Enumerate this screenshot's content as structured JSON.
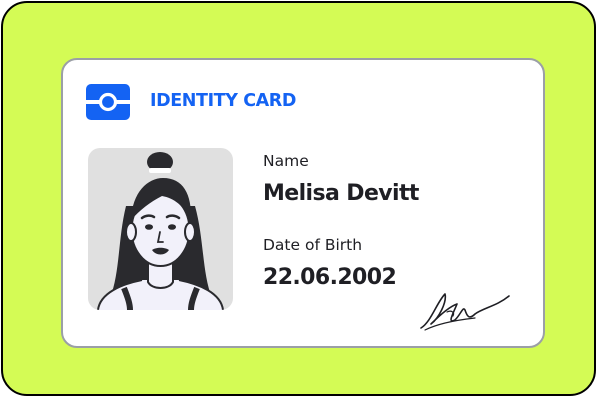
{
  "card": {
    "header_title": "IDENTITY CARD",
    "logo_icon": "id-badge-icon",
    "name_label": "Name",
    "name_value": "Melisa Devitt",
    "dob_label": "Date of Birth",
    "dob_value": "22.06.2002",
    "photo": "portrait-illustration",
    "signature": "signature-scribble"
  },
  "colors": {
    "background": "#d4fb55",
    "card": "#ffffff",
    "accent": "#1463f3",
    "text": "#1f1f24",
    "photo_bg": "#e0e0e0"
  }
}
